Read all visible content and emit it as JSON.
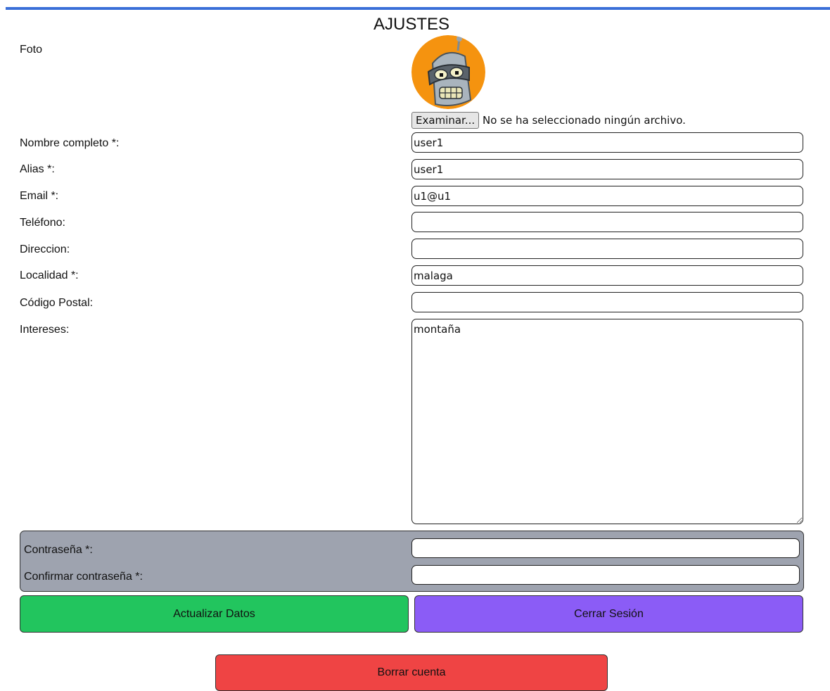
{
  "header": {
    "title": "AJUSTES"
  },
  "photo": {
    "label": "Foto",
    "browse_label": "Examinar...",
    "file_status": "No se ha seleccionado ningún archivo."
  },
  "form": {
    "nombre": {
      "label": "Nombre completo *:",
      "value": "user1"
    },
    "alias": {
      "label": "Alias *:",
      "value": "user1"
    },
    "email": {
      "label": "Email *:",
      "value": "u1@u1"
    },
    "telefono": {
      "label": "Teléfono:",
      "value": ""
    },
    "direccion": {
      "label": "Direccion:",
      "value": ""
    },
    "localidad": {
      "label": "Localidad *:",
      "value": "malaga"
    },
    "codigo_postal": {
      "label": "Código Postal:",
      "value": ""
    },
    "intereses": {
      "label": "Intereses:",
      "value": "montaña"
    }
  },
  "password": {
    "password_label": "Contraseña *:",
    "confirm_label": "Confirmar contraseña *:"
  },
  "actions": {
    "update_label": "Actualizar Datos",
    "logout_label": "Cerrar Sesión",
    "delete_label": "Borrar cuenta"
  },
  "colors": {
    "accent_bar": "#3a6fd8",
    "update_button": "#22c55e",
    "logout_button": "#8b5cf6",
    "delete_button": "#ef4444",
    "password_panel": "#9ea3af"
  }
}
